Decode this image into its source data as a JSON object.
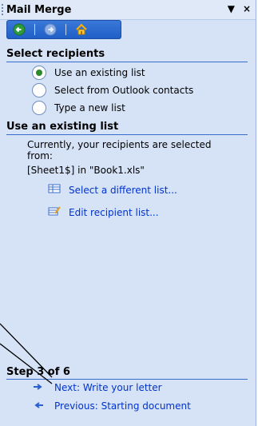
{
  "pane": {
    "title": "Mail Merge",
    "controls": {
      "dropdown": "▼",
      "close": "×"
    },
    "nav_icons": [
      "back-icon",
      "forward-icon",
      "home-icon"
    ]
  },
  "select_recipients": {
    "header": "Select recipients",
    "options": [
      {
        "label": "Use an existing list",
        "selected": true
      },
      {
        "label": "Select from Outlook contacts",
        "selected": false
      },
      {
        "label": "Type a new list",
        "selected": false
      }
    ]
  },
  "existing_list": {
    "header": "Use an existing list",
    "description": "Currently, your recipients are selected from:",
    "source": "[Sheet1$] in \"Book1.xls\"",
    "links": [
      {
        "label": "Select a different list...",
        "icon": "list-table-icon"
      },
      {
        "label": "Edit recipient list...",
        "icon": "edit-list-icon"
      }
    ]
  },
  "step": {
    "label": "Step 3 of 6",
    "next": "Next: Write your letter",
    "previous": "Previous: Starting document"
  },
  "colors": {
    "pane_bg": "#d6e3f7",
    "link": "#0033cc",
    "header_rule": "#3a6ccd",
    "radio_selected": "#2d8a2d"
  }
}
